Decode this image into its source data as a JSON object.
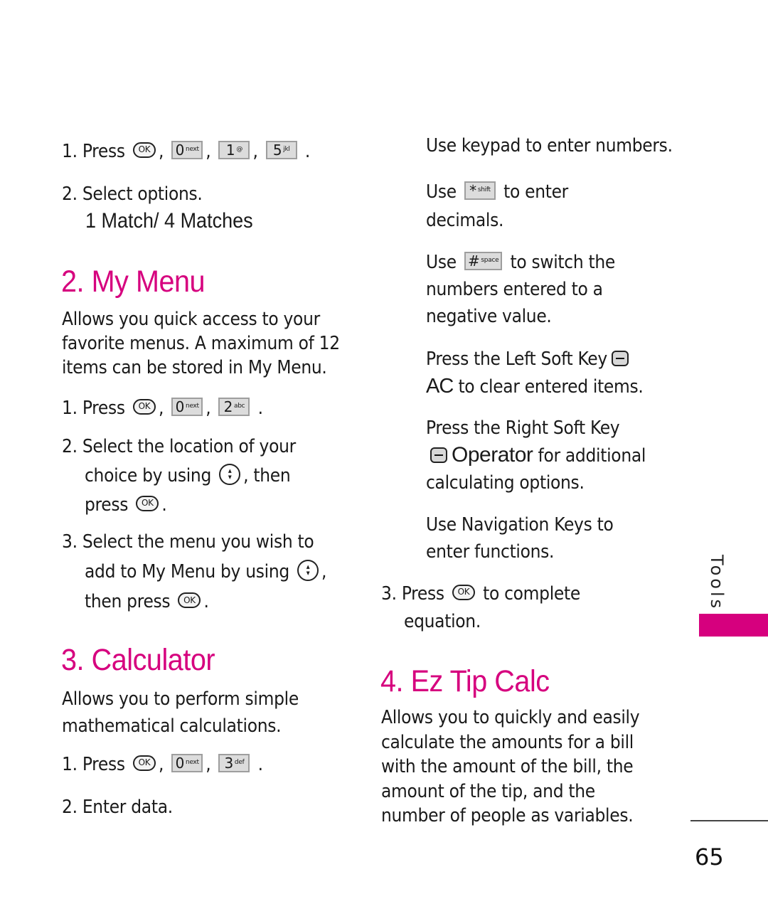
{
  "colors": {
    "accent": "#d6007e",
    "key_fill": "#dcdcdc",
    "key_border": "#9e9e9e"
  },
  "left": {
    "s1": {
      "step1": {
        "prefix": "1. Press",
        "keys": [
          {
            "icon": "ok-key-icon",
            "label": "OK"
          },
          {
            "icon": "zero-key-icon",
            "num": "0",
            "sub": "next"
          },
          {
            "icon": "one-key-icon",
            "num": "1",
            "sub": "@"
          },
          {
            "icon": "five-key-icon",
            "num": "5",
            "sub": "jkl"
          }
        ],
        "sep": ",",
        "end": "."
      },
      "step2": "2. Select options.",
      "options": "1 Match/ 4 Matches"
    },
    "my_menu": {
      "title": "2. My Menu",
      "desc": [
        "Allows you quick access to your",
        "favorite menus. A maximum of 12",
        "items can be stored in My Menu."
      ],
      "step1": {
        "prefix": "1. Press",
        "keys": [
          {
            "label": "OK"
          },
          {
            "num": "0",
            "sub": "next"
          },
          {
            "num": "2",
            "sub": "abc"
          }
        ]
      },
      "step2": [
        "2. Select the location of your",
        "choice by using",
        ", then",
        "press",
        "."
      ],
      "step3": [
        "3. Select the menu you wish to",
        "add to My Menu by using",
        ",",
        "then press",
        "."
      ]
    },
    "calculator": {
      "title": "3. Calculator",
      "desc": [
        "Allows you to perform simple",
        "mathematical calculations."
      ],
      "step1": {
        "prefix": "1. Press",
        "keys": [
          {
            "label": "OK"
          },
          {
            "num": "0",
            "sub": "next"
          },
          {
            "num": "3",
            "sub": "def"
          }
        ]
      },
      "step2": "2. Enter data."
    }
  },
  "right": {
    "p1": "Use keypad to enter numbers.",
    "p2": {
      "pre": "Use",
      "key": {
        "num": "*",
        "sub": "shift"
      },
      "post": "to enter",
      "line2": "decimals."
    },
    "p3": {
      "pre": "Use",
      "key": {
        "num": "#",
        "sub": "space"
      },
      "post": "to switch the",
      "line2": "numbers entered to a",
      "line3": "negative value."
    },
    "p4": {
      "line1": "Press the Left Soft Key",
      "ac": "AC",
      "line2": "to clear entered items."
    },
    "p5": {
      "line1": "Press the Right Soft Key",
      "op": "Operator",
      "line2": "for additional",
      "line3": "calculating options."
    },
    "p6": [
      "Use Navigation Keys to",
      "enter functions."
    ],
    "step3": {
      "pre": "3. Press",
      "ok": "OK",
      "post": "to complete",
      "line2": "equation."
    },
    "ez_tip": {
      "title": "4. Ez Tip Calc",
      "desc": [
        "Allows you to quickly and easily",
        "calculate the amounts for a bill",
        "with the amount of the bill, the",
        "amount of the tip, and the",
        "number of people as variables."
      ]
    }
  },
  "side_tab": {
    "label": "Tools"
  },
  "page_number": "65"
}
